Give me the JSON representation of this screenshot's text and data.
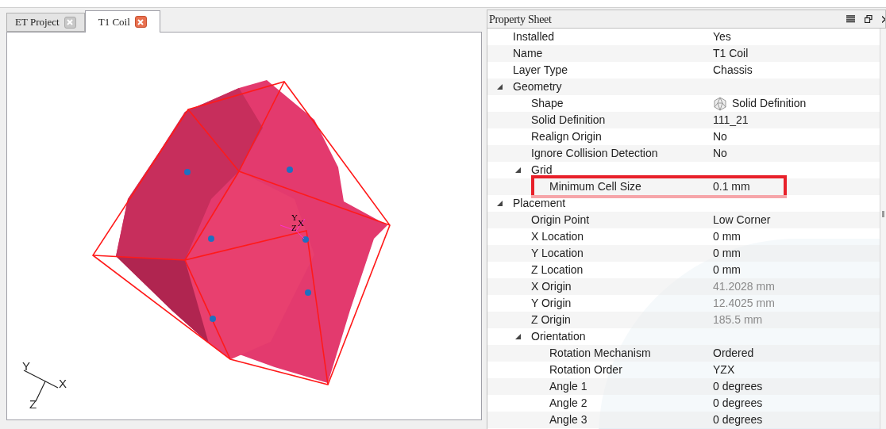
{
  "tabs": [
    {
      "label": "ET Project",
      "selected": false
    },
    {
      "label": "T1 Coil",
      "selected": true
    }
  ],
  "viewport": {
    "origin_axes": [
      "Y",
      "Z",
      "X"
    ],
    "corner_axes": [
      "Y",
      "X",
      "Z"
    ]
  },
  "property_sheet": {
    "title": "Property Sheet",
    "rows": [
      {
        "kind": "property",
        "name": "Installed",
        "value": "Yes"
      },
      {
        "kind": "property",
        "name": "Name",
        "value": "T1 Coil"
      },
      {
        "kind": "property",
        "name": "Layer Type",
        "value": "Chassis"
      },
      {
        "kind": "group",
        "name": "Geometry",
        "expanded": true,
        "children": [
          {
            "kind": "property",
            "name": "Shape",
            "value": "Solid Definition",
            "value_icon": true
          },
          {
            "kind": "property",
            "name": "Solid Definition",
            "value": "111_21"
          },
          {
            "kind": "property",
            "name": "Realign Origin",
            "value": "No"
          },
          {
            "kind": "property",
            "name": "Ignore Collision Detection",
            "value": "No"
          },
          {
            "kind": "group",
            "name": "Grid",
            "expanded": true,
            "children": [
              {
                "kind": "property",
                "name": "Minimum Cell Size",
                "value": "0.1 mm",
                "highlighted": true
              }
            ]
          }
        ]
      },
      {
        "kind": "group",
        "name": "Placement",
        "expanded": true,
        "children": [
          {
            "kind": "property",
            "name": "Origin Point",
            "value": "Low Corner"
          },
          {
            "kind": "property",
            "name": "X Location",
            "value": "0 mm"
          },
          {
            "kind": "property",
            "name": "Y Location",
            "value": "0 mm"
          },
          {
            "kind": "property",
            "name": "Z Location",
            "value": "0 mm"
          },
          {
            "kind": "property",
            "name": "X Origin",
            "value": "41.2028 mm",
            "disabled": true
          },
          {
            "kind": "property",
            "name": "Y Origin",
            "value": "12.4025 mm",
            "disabled": true
          },
          {
            "kind": "property",
            "name": "Z Origin",
            "value": "185.5 mm",
            "disabled": true
          },
          {
            "kind": "group",
            "name": "Orientation",
            "expanded": true,
            "children": [
              {
                "kind": "property",
                "name": "Rotation Mechanism",
                "value": "Ordered"
              },
              {
                "kind": "property",
                "name": "Rotation Order",
                "value": "YZX"
              },
              {
                "kind": "property",
                "name": "Angle 1",
                "value": "0 degrees"
              },
              {
                "kind": "property",
                "name": "Angle 2",
                "value": "0 degrees"
              },
              {
                "kind": "property",
                "name": "Angle 3",
                "value": "0 degrees"
              }
            ]
          }
        ]
      }
    ]
  }
}
